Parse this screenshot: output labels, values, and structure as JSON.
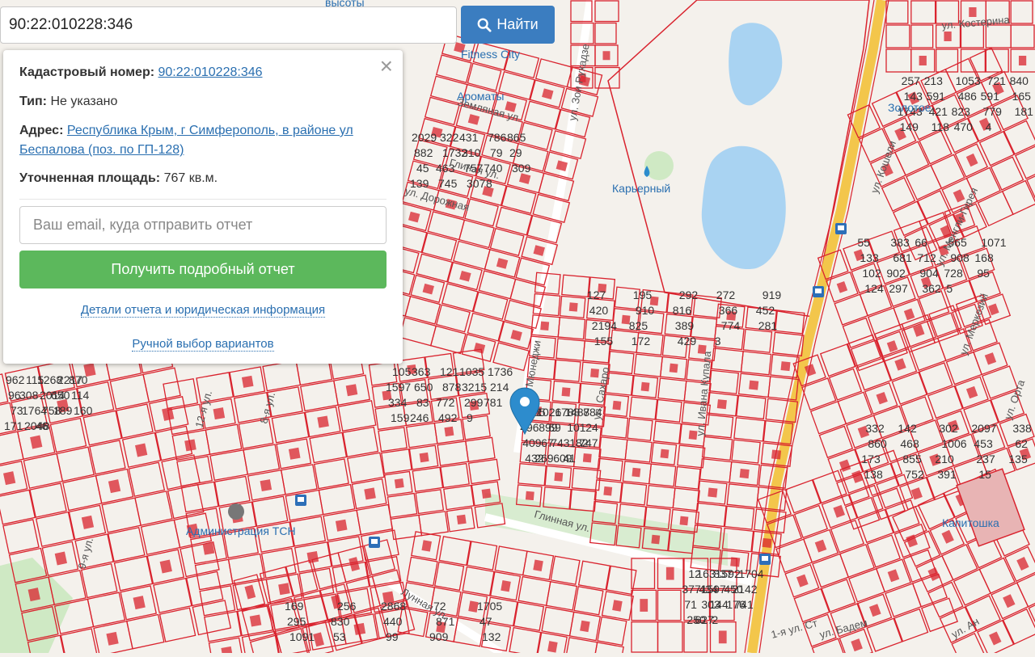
{
  "search": {
    "value": "90:22:010228:346",
    "button_label": "Найти"
  },
  "popup": {
    "cadastral_label": "Кадастровый номер:",
    "cadastral_value": "90:22:010228:346",
    "type_label": "Тип:",
    "type_value": "Не указано",
    "address_label": "Адрес:",
    "address_value": "Республика Крым, г Симферополь, в районе ул Беспалова (поз. по ГП-128)",
    "area_label": "Уточненная площадь:",
    "area_value": "767 кв.м.",
    "email_placeholder": "Ваш email, куда отправить отчет",
    "report_button": "Получить подробный отчет",
    "details_link": "Детали отчета и юридическая информация",
    "manual_link": "Ручной выбор вариантов",
    "close": "×"
  },
  "map": {
    "colors": {
      "parcel": "#d9232e",
      "road": "#f3c64b",
      "water": "#a9d3f2",
      "park": "#cfe9c4",
      "background": "#f4f1ec",
      "marker": "#2d8ccd"
    },
    "plot_labels": [
      "127",
      "257",
      "55",
      "332",
      "2029",
      "105",
      "169",
      "305",
      "962",
      "12",
      "195",
      "213",
      "383",
      "142",
      "322",
      "363",
      "256",
      "1026",
      "115",
      "1631",
      "292",
      "1053",
      "66",
      "302",
      "431",
      "121",
      "2868",
      "1788",
      "1268",
      "837",
      "272",
      "721",
      "565",
      "2097",
      "786",
      "1035",
      "72",
      "1487",
      "2217",
      "592",
      "919",
      "840",
      "1071",
      "338",
      "865",
      "1736",
      "1705",
      "884",
      "870",
      "1704",
      "420",
      "143",
      "133",
      "860",
      "882",
      "1597",
      "295",
      "496",
      "96",
      "3771",
      "910",
      "591",
      "681",
      "468",
      "1732",
      "650",
      "830",
      "899",
      "308",
      "434",
      "816",
      "486",
      "712",
      "1006",
      "310",
      "878",
      "440",
      "69",
      "2014",
      "597",
      "366",
      "591",
      "908",
      "453",
      "79",
      "3215",
      "871",
      "101",
      "650",
      "450",
      "452",
      "165",
      "168",
      "62",
      "29",
      "214",
      "47",
      "24",
      "114",
      "2142",
      "2194",
      "1743",
      "102",
      "173",
      "45",
      "334",
      "1091",
      "409",
      "73",
      "71",
      "825",
      "421",
      "902",
      "855",
      "463",
      "83",
      "53",
      "67",
      "1764",
      "303",
      "389",
      "823",
      "904",
      "210",
      "757",
      "772",
      "99",
      "743",
      "758",
      "144",
      "774",
      "779",
      "728",
      "237",
      "740",
      "299",
      "909",
      "182",
      "189",
      "176",
      "281",
      "181",
      "95",
      "135",
      "309",
      "781",
      "132",
      "747",
      "160",
      "741",
      "155",
      "149",
      "124",
      "138",
      "139",
      "159",
      "378",
      "432",
      "171",
      "250",
      "172",
      "118",
      "297",
      "752",
      "745",
      "246",
      "403",
      "269",
      "2048",
      "627",
      "429",
      "470",
      "362",
      "391",
      "307",
      "492",
      "487",
      "609",
      "46",
      "2",
      "3",
      "4",
      "5",
      "15",
      "8",
      "9",
      "50",
      "41"
    ],
    "streets": [
      "ул. Зои Рухадзе",
      "ул. Костерина",
      "ул. Кошели",
      "ул. Менгли-Гирея",
      "ул. Меркезий",
      "ул. Орта",
      "Глинная ул.",
      "Лунная ул.",
      "ул. Сахаро",
      "ул. Ивана Купала",
      "ул. Мюнеджи",
      "1-я ул. Ст",
      "ул. Бадем",
      "ул. Ан",
      "12-я ул.",
      "8-я ул.",
      "9-я ул.",
      "Глиная ул.",
      "ул. Дорожная",
      "Земляная ул."
    ],
    "places": [
      "Карьерный",
      "Администрация ТСН",
      "Капитошка",
      "Fitness City",
      "Золотое",
      "Ароматы",
      "высоты"
    ]
  }
}
